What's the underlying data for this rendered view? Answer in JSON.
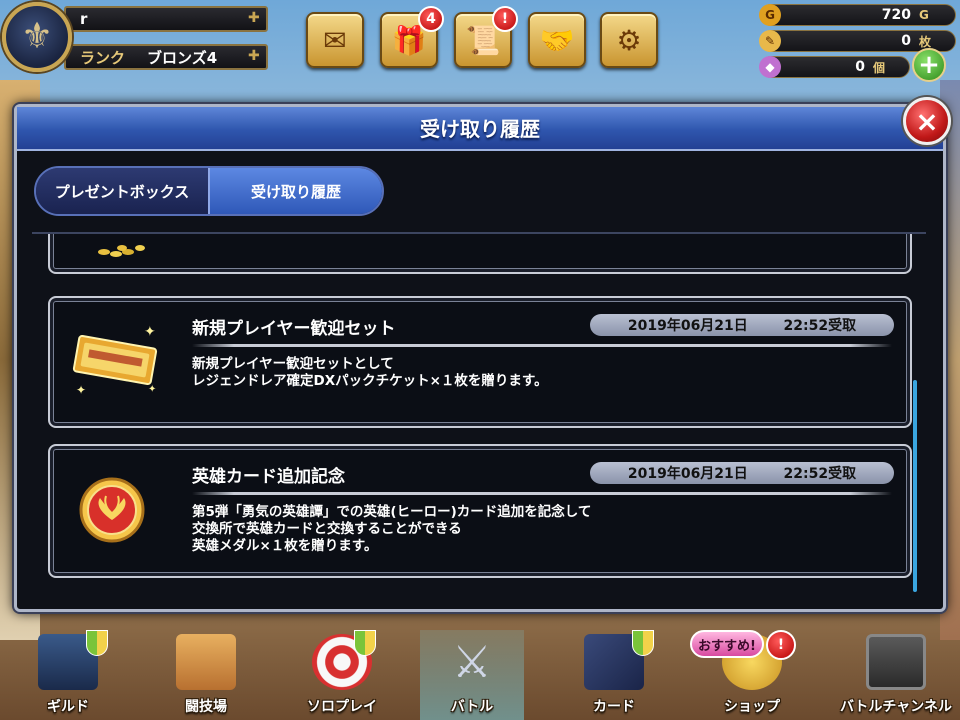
{
  "player": {
    "name": "r",
    "rank_label": "ランク",
    "rank_value": "ブロンズ4"
  },
  "hud": {
    "mail_icon": "envelope-icon",
    "gift_icon": "gift-icon",
    "gift_badge": "4",
    "quest_icon": "scroll-icon",
    "quest_badge": "!",
    "friend_icon": "handshake-icon",
    "settings_icon": "gear-icon"
  },
  "currency": [
    {
      "icon": "gold-coin-icon",
      "icon_text": "G",
      "value": "720",
      "unit": "G",
      "color": "#e0a020"
    },
    {
      "icon": "ticket-icon",
      "icon_text": "✎",
      "value": "0",
      "unit": "枚",
      "color": "#e8b84a"
    },
    {
      "icon": "gem-icon",
      "icon_text": "◆",
      "value": "0",
      "unit": "個",
      "color": "#c070d0"
    }
  ],
  "modal": {
    "title": "受け取り履歴",
    "close_label": "×",
    "tabs": [
      {
        "label": "プレゼントボックス",
        "active": false
      },
      {
        "label": "受け取り履歴",
        "active": true
      }
    ],
    "items": [
      {
        "title": "新規プレイヤー歓迎セット",
        "date": "2019年06月21日",
        "time": "22:52受取",
        "desc_lines": [
          "新規プレイヤー歓迎セットとして",
          "レジェンドレア確定DXパックチケット×１枚を贈ります。"
        ],
        "icon": "gold-ticket-icon"
      },
      {
        "title": "英雄カード追加記念",
        "date": "2019年06月21日",
        "time": "22:52受取",
        "desc_lines": [
          "第5弾「勇気の英雄譚」での英雄(ヒーロー)カード追加を記念して",
          "交換所で英雄カードと交換することができる",
          "英雄メダル×１枚を贈ります。"
        ],
        "icon": "hero-medal-icon"
      }
    ]
  },
  "nav": {
    "items": [
      {
        "label": "ギルド",
        "icon": "guild-banner-icon"
      },
      {
        "label": "闘技場",
        "icon": "arena-tickets-icon"
      },
      {
        "label": "ソロプレイ",
        "icon": "target-icon"
      },
      {
        "label": "バトル",
        "icon": "crossed-swords-icon"
      },
      {
        "label": "カード",
        "icon": "cards-icon"
      },
      {
        "label": "ショップ",
        "icon": "shop-coins-icon"
      },
      {
        "label": "バトルチャンネル",
        "icon": "tv-icon"
      }
    ],
    "osusume": "おすすめ!",
    "shop_badge": "!"
  }
}
